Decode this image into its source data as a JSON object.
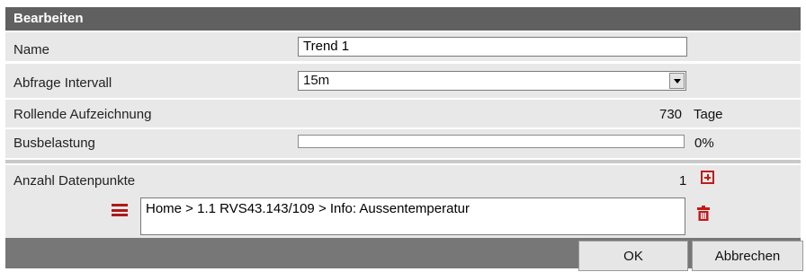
{
  "dialog": {
    "title": "Bearbeiten"
  },
  "fields": {
    "name_label": "Name",
    "name_value": "Trend 1",
    "interval_label": "Abfrage Intervall",
    "interval_value": "15m",
    "rolling_label": "Rollende Aufzeichnung",
    "rolling_value": "730",
    "rolling_unit": "Tage",
    "busload_label": "Busbelastung",
    "busload_percent_text": "0%",
    "busload_fraction": 0,
    "datapoints_label": "Anzahl Datenpunkte",
    "datapoints_count": "1"
  },
  "datapoint": {
    "path": "Home > 1.1 RVS43.143/109 > Info: Aussentemperatur"
  },
  "icons": {
    "add": "plus-square-icon",
    "drag": "hamburger-icon",
    "delete": "trash-icon"
  },
  "buttons": {
    "ok": "OK",
    "cancel": "Abbrechen"
  },
  "colors": {
    "titlebar": "#606060",
    "row_bg": "#e8e8e8",
    "accent_red": "#c21a1a",
    "footer": "#777777"
  }
}
